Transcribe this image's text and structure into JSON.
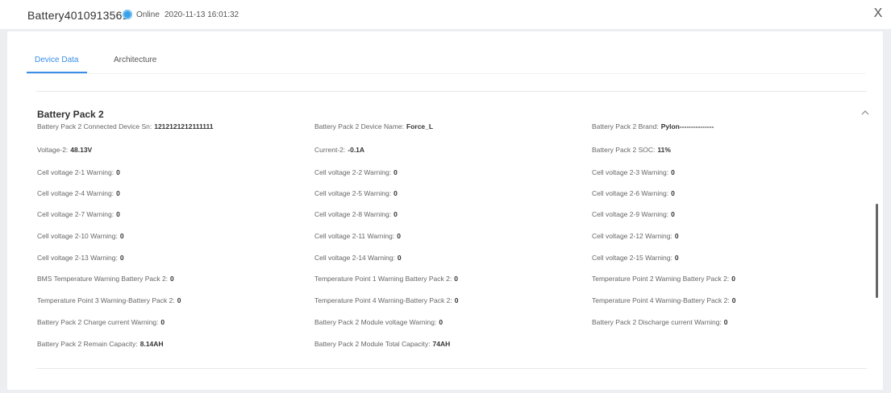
{
  "header": {
    "device_title": "Battery4010913561",
    "status": "Online",
    "timestamp": "2020-11-13 16:01:32",
    "close_label": "X",
    "status_color": "#3aa0e8"
  },
  "tabs": [
    {
      "label": "Device Data",
      "active": true
    },
    {
      "label": "Architecture",
      "active": false
    }
  ],
  "accent_color": "#3a8ee6",
  "section": {
    "title": "Battery Pack 2",
    "rows": [
      [
        {
          "label": "Battery Pack 2 Connected Device Sn:",
          "value": "1212121212111111"
        },
        {
          "label": "Battery Pack 2 Device Name:",
          "value": "Force_L"
        },
        {
          "label": "Battery Pack 2 Brand:",
          "value": "Pylon---------------"
        }
      ],
      [
        {
          "label": "Voltage-2:",
          "value": "48.13V"
        },
        {
          "label": "Current-2:",
          "value": "-0.1A"
        },
        {
          "label": "Battery Pack 2 SOC:",
          "value": "11%"
        }
      ],
      [
        {
          "label": "Cell voltage 2-1 Warning:",
          "value": "0"
        },
        {
          "label": "Cell voltage 2-2 Warning:",
          "value": "0"
        },
        {
          "label": "Cell voltage 2-3 Warning:",
          "value": "0"
        }
      ],
      [
        {
          "label": "Cell voltage 2-4 Warning:",
          "value": "0"
        },
        {
          "label": "Cell voltage 2-5 Warning:",
          "value": "0"
        },
        {
          "label": "Cell voltage 2-6 Warning:",
          "value": "0"
        }
      ],
      [
        {
          "label": "Cell voltage 2-7 Warning:",
          "value": "0"
        },
        {
          "label": "Cell voltage 2-8 Warning:",
          "value": "0"
        },
        {
          "label": "Cell voltage 2-9 Warning:",
          "value": "0"
        }
      ],
      [
        {
          "label": "Cell voltage 2-10 Warning:",
          "value": "0"
        },
        {
          "label": "Cell voltage 2-11 Warning:",
          "value": "0"
        },
        {
          "label": "Cell voltage 2-12 Warning:",
          "value": "0"
        }
      ],
      [
        {
          "label": "Cell voltage 2-13 Warning:",
          "value": "0"
        },
        {
          "label": "Cell voltage 2-14 Warning:",
          "value": "0"
        },
        {
          "label": "Cell voltage 2-15 Warning:",
          "value": "0"
        }
      ],
      [
        {
          "label": "BMS Temperature Warning Battery Pack 2:",
          "value": "0"
        },
        {
          "label": "Temperature Point 1 Warning Battery Pack 2:",
          "value": "0"
        },
        {
          "label": "Temperature Point 2 Warning Battery Pack 2:",
          "value": "0"
        }
      ],
      [
        {
          "label": "Temperature Point 3 Warning-Battery Pack 2:",
          "value": "0"
        },
        {
          "label": "Temperature Point 4 Warning-Battery Pack 2:",
          "value": "0"
        },
        {
          "label": "Temperature Point 4 Warning-Battery Pack 2:",
          "value": "0"
        }
      ],
      [
        {
          "label": "Battery Pack 2 Charge current Warning:",
          "value": "0"
        },
        {
          "label": "Battery Pack 2 Module voltage Warning:",
          "value": "0"
        },
        {
          "label": "Battery Pack 2 Discharge current Warning:",
          "value": "0"
        }
      ],
      [
        {
          "label": "Battery Pack 2 Remain Capacity:",
          "value": "8.14AH"
        },
        {
          "label": "Battery Pack 2 Module Total Capacity:",
          "value": "74AH"
        }
      ]
    ]
  }
}
